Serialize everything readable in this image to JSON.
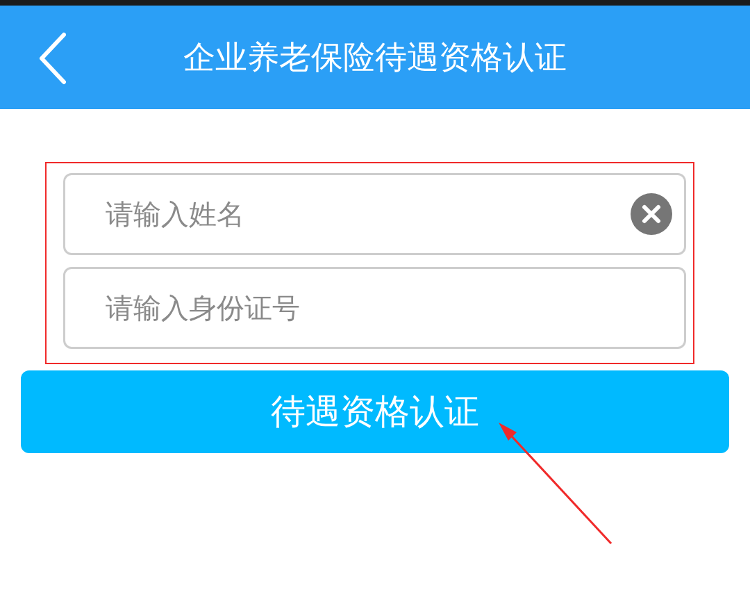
{
  "header": {
    "title": "企业养老保险待遇资格认证"
  },
  "fields": [
    {
      "placeholder": "请输入姓名",
      "clearable": true
    },
    {
      "placeholder": "请输入身份证号",
      "clearable": false
    }
  ],
  "submit_button": {
    "label": "待遇资格认证"
  }
}
